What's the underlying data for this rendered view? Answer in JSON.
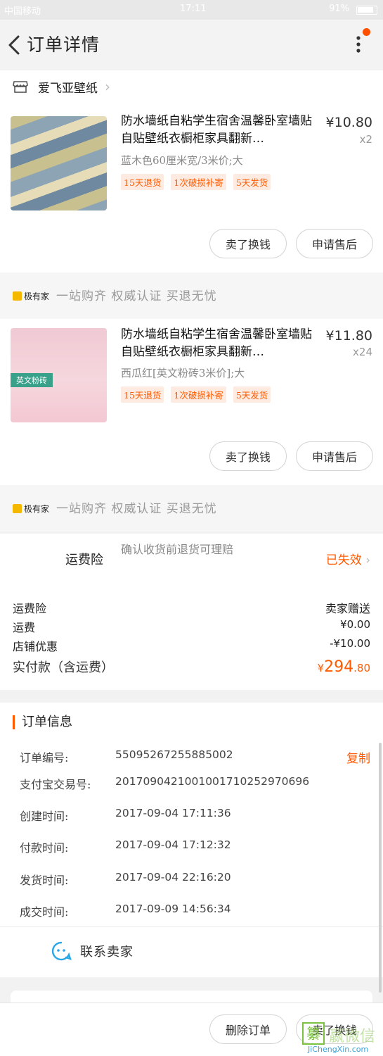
{
  "status_bar": {
    "carrier": "中国移动",
    "time": "17:11",
    "battery": "91%"
  },
  "nav": {
    "title": "订单详情"
  },
  "shop": {
    "name": "爱飞亚壁纸"
  },
  "items": [
    {
      "title": "防水墙纸自粘学生宿舍温馨卧室墙贴自贴壁纸衣橱柜家具翻新…",
      "price": "¥10.80",
      "qty": "x2",
      "sku": "蓝木色60厘米宽/3米价;大",
      "tags": [
        "15天退货",
        "1次破损补寄",
        "5天发货"
      ],
      "thumb_text": "",
      "buttons": [
        "卖了换钱",
        "申请售后"
      ]
    },
    {
      "title": "防水墙纸自粘学生宿舍温馨卧室墙贴自贴壁纸衣橱柜家具翻新…",
      "price": "¥11.80",
      "qty": "x24",
      "sku": "西瓜红[英文粉砖3米价];大",
      "tags": [
        "15天退货",
        "1次破损补寄",
        "5天发货"
      ],
      "thumb_text": "英文粉砖",
      "buttons": [
        "卖了换钱",
        "申请售后"
      ]
    }
  ],
  "slogan": {
    "logo": "极有家",
    "text": "一站购齐 权威认证 买退无忧"
  },
  "insurance": {
    "title": "运费险",
    "desc": "确认收货前退货可理赔",
    "status": "已失效"
  },
  "fees": [
    {
      "label": "运费险",
      "value": "卖家赠送"
    },
    {
      "label": "运费",
      "value": "¥0.00"
    },
    {
      "label": "店铺优惠",
      "value": "-¥10.00"
    }
  ],
  "total": {
    "label": "实付款（含运费）",
    "currency": "¥",
    "integer": "294",
    "decimal": ".80"
  },
  "order_info": {
    "title": "订单信息",
    "copy": "复制",
    "rows": [
      {
        "label": "订单编号:",
        "value": "55095267255885002"
      },
      {
        "label": "支付宝交易号:",
        "value": "2017090421001001710252970696"
      },
      {
        "label": "创建时间:",
        "value": "2017-09-04 17:11:36"
      },
      {
        "label": "付款时间:",
        "value": "2017-09-04 17:12:32"
      },
      {
        "label": "发货时间:",
        "value": "2017-09-04 22:16:20"
      },
      {
        "label": "成交时间:",
        "value": "2017-09-09 14:56:34"
      }
    ],
    "contact": "联系卖家"
  },
  "bottom": {
    "buttons": [
      "删除订单",
      "卖了换钱"
    ]
  },
  "watermark": {
    "cn": "嬴微信",
    "en": "JiChengXin.com"
  },
  "colors": {
    "accent": "#ff5a00",
    "tag_bg": "#fdebe1"
  }
}
